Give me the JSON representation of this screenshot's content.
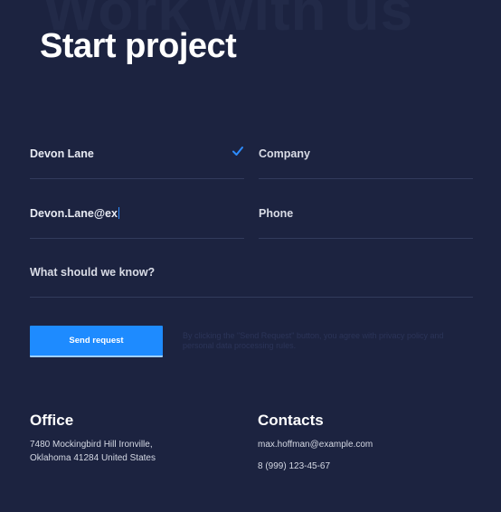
{
  "background_heading": "Work with us",
  "title": "Start project",
  "form": {
    "name_value": "Devon Lane",
    "company_placeholder": "Company",
    "email_value": "Devon.Lane@ex",
    "phone_placeholder": "Phone",
    "message_placeholder": "What should we know?",
    "submit_label": "Send request",
    "disclaimer": "By clicking the \"Send Request\" button, you agree with privacy policy and personal data processing rules."
  },
  "office": {
    "title": "Office",
    "address_line1": "7480 Mockingbird Hill Ironville,",
    "address_line2": "Oklahoma 41284 United States"
  },
  "contacts": {
    "title": "Contacts",
    "email": "max.hoffman@example.com",
    "phone": "8 (999) 123-45-67"
  },
  "colors": {
    "background": "#1c2340",
    "accent": "#1e8bff",
    "divider": "#323b5c"
  },
  "icons": {
    "name_valid": "checkmark-icon"
  }
}
